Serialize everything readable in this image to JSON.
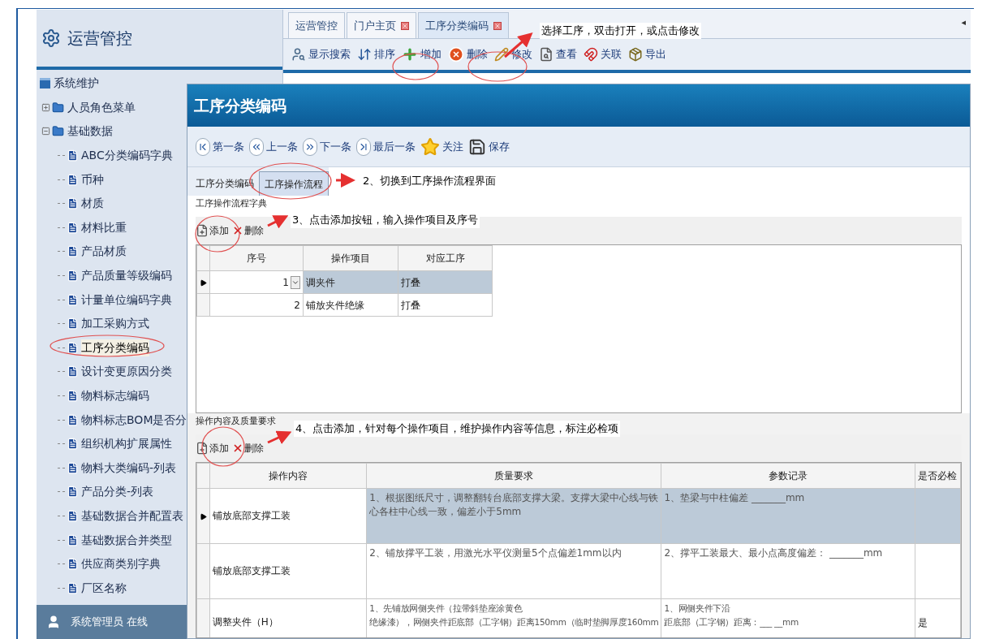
{
  "sidebar": {
    "title": "运营管控",
    "tree": [
      {
        "label": "系统维护",
        "expanded": true,
        "children": [
          {
            "label": "人员角色菜单",
            "expanded": false
          },
          {
            "label": "基础数据",
            "expanded": true,
            "children": [
              {
                "label": "ABC分类编码字典",
                "selected": false
              },
              {
                "label": "币种",
                "selected": false
              },
              {
                "label": "材质",
                "selected": false
              },
              {
                "label": "材料比重",
                "selected": false
              },
              {
                "label": "产品材质",
                "selected": false
              },
              {
                "label": "产品质量等级编码",
                "selected": false
              },
              {
                "label": "计量单位编码字典",
                "selected": false
              },
              {
                "label": "加工采购方式",
                "selected": false
              },
              {
                "label": "工序分类编码",
                "selected": true
              },
              {
                "label": "设计变更原因分类",
                "selected": false
              },
              {
                "label": "物料标志编码",
                "selected": false
              },
              {
                "label": "物料标志BOM是否分",
                "selected": false
              },
              {
                "label": "组织机构扩展属性",
                "selected": false
              },
              {
                "label": "物料大类编码-列表",
                "selected": false
              },
              {
                "label": "产品分类-列表",
                "selected": false
              },
              {
                "label": "基础数据合并配置表",
                "selected": false
              },
              {
                "label": "基础数据合并类型",
                "selected": false
              },
              {
                "label": "供应商类别字典",
                "selected": false
              },
              {
                "label": "厂区名称",
                "selected": false
              }
            ]
          }
        ]
      }
    ],
    "status": "系统管理员 在线"
  },
  "main": {
    "tabs": [
      {
        "label": "运营管控",
        "selected": false,
        "closable": false
      },
      {
        "label": "门户主页",
        "selected": false,
        "closable": true
      },
      {
        "label": "工序分类编码",
        "selected": true,
        "closable": true
      }
    ],
    "tab_scroll": "◂",
    "toolbar": [
      {
        "label": "显示搜索",
        "kind": "search"
      },
      {
        "label": "排序",
        "kind": "sort"
      },
      {
        "label": "增加",
        "kind": "add"
      },
      {
        "label": "删除",
        "kind": "delete"
      },
      {
        "label": "修改",
        "kind": "edit"
      },
      {
        "label": "查看",
        "kind": "view"
      },
      {
        "label": "关联",
        "kind": "link"
      },
      {
        "label": "导出",
        "kind": "export"
      }
    ]
  },
  "dialog": {
    "title": "工序分类编码",
    "nav": [
      {
        "label": "第一条",
        "kind": "first"
      },
      {
        "label": "上一条",
        "kind": "prev"
      },
      {
        "label": "下一条",
        "kind": "next"
      },
      {
        "label": "最后一条",
        "kind": "last"
      },
      {
        "label": "关注",
        "kind": "star"
      },
      {
        "label": "保存",
        "kind": "save"
      }
    ],
    "tabs": [
      {
        "label": "工序分类编码",
        "selected": false
      },
      {
        "label": "工序操作流程",
        "selected": true
      }
    ],
    "flow": {
      "legend": "工序操作流程字典",
      "actions": [
        {
          "label": "添加",
          "kind": "new"
        },
        {
          "label": "删除",
          "kind": "remove"
        }
      ],
      "columns": [
        "序号",
        "操作项目",
        "对应工序"
      ],
      "rows": [
        {
          "cells": [
            "1",
            "调夹件",
            "打叠"
          ],
          "selected": true,
          "dropdown": true
        },
        {
          "cells": [
            "2",
            "铺放夹件绝缘",
            "打叠"
          ],
          "selected": false,
          "dropdown": false
        }
      ]
    },
    "content": {
      "legend": "操作内容及质量要求",
      "actions": [
        {
          "label": "添加",
          "kind": "new"
        },
        {
          "label": "删除",
          "kind": "remove"
        }
      ],
      "columns": [
        "操作内容",
        "质量要求",
        "参数记录",
        "是否必检"
      ],
      "rows": [
        {
          "cells": [
            [
              "铺放底部支撑工装"
            ],
            [
              "1、根据图纸尺寸，调整翻转台底部支撑大梁。支撑大梁中心线与铁心各柱中心线一致，偏差小于5mm"
            ],
            [
              "1、垫梁与中柱偏差 _______mm"
            ]
          ],
          "selected": true
        },
        {
          "cells": [
            [
              "铺放底部支撑工装"
            ],
            [
              "2、铺放撑平工装，用激光水平仪测量5个点偏差1mm以内"
            ],
            [
              "2、撑平工装最大、最小点高度偏差： _______mm"
            ]
          ],
          "selected": false
        },
        {
          "cells": [
            [
              "调整夹件（H）"
            ],
            [
              "1、先铺放网侧夹件（拉带斜垫座涂黄色",
              "绝缘漆），网侧夹件距底部（工字钢）距离150mm（临时垫脚厚度160mm"
            ],
            [
              "1、网侧夹件下沿",
              "距底部（工字钢）距离：___ __mm"
            ]
          ],
          "selected": false,
          "required": "是"
        }
      ]
    }
  },
  "annotations": [
    {
      "text": "选择工序，双击打开，或点击修改"
    },
    {
      "text": "2、切换到工序操作流程界面"
    },
    {
      "text": "3、点击添加按钮，输入操作项目及序号"
    },
    {
      "text": "4、点击添加，针对每个操作项目，维护操作内容等信息，标注必检项"
    }
  ]
}
